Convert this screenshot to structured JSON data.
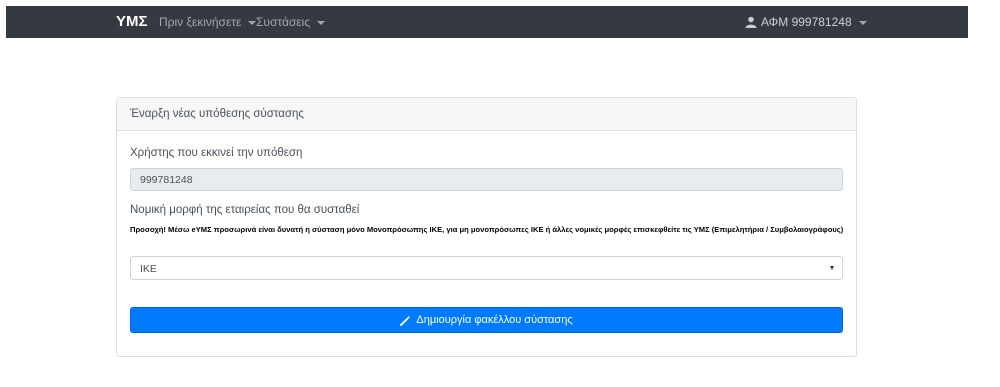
{
  "navbar": {
    "brand": "ΥΜΣ",
    "menu": [
      {
        "label": "Πριν ξεκινήσετε"
      },
      {
        "label": "Συστάσεις"
      }
    ],
    "user": {
      "label": "ΑΦΜ 999781248",
      "icon": "user-icon"
    }
  },
  "form": {
    "header": "Έναρξη νέας υπόθεσης σύστασης",
    "user_label": "Χρήστης που εκκινεί την υπόθεση",
    "user_value": "999781248",
    "legal_form_label": "Νομική μορφή της εταιρείας που θα συσταθεί",
    "warning_text": "Προσοχή! Μέσω eΥΜΣ προσωρινά είναι δυνατή η σύσταση μόνο Μονοπρόσωπης ΙΚΕ, για μη μονοπρόσωπες ΙΚΕ ή άλλες νομικές μορφές επισκεφθείτε τις ΥΜΣ (Επιμελητήρια / Συμβολαιογράφους)",
    "legal_form_selected": "ΙΚΕ",
    "submit_label": "Δημιουργία φακέλλου σύστασης",
    "submit_icon": "magic-wand-icon"
  },
  "colors": {
    "navbar_bg": "#343a40",
    "primary": "#007bff",
    "readonly_bg": "#e9ecef",
    "card_header_bg": "#f7f7f7"
  }
}
